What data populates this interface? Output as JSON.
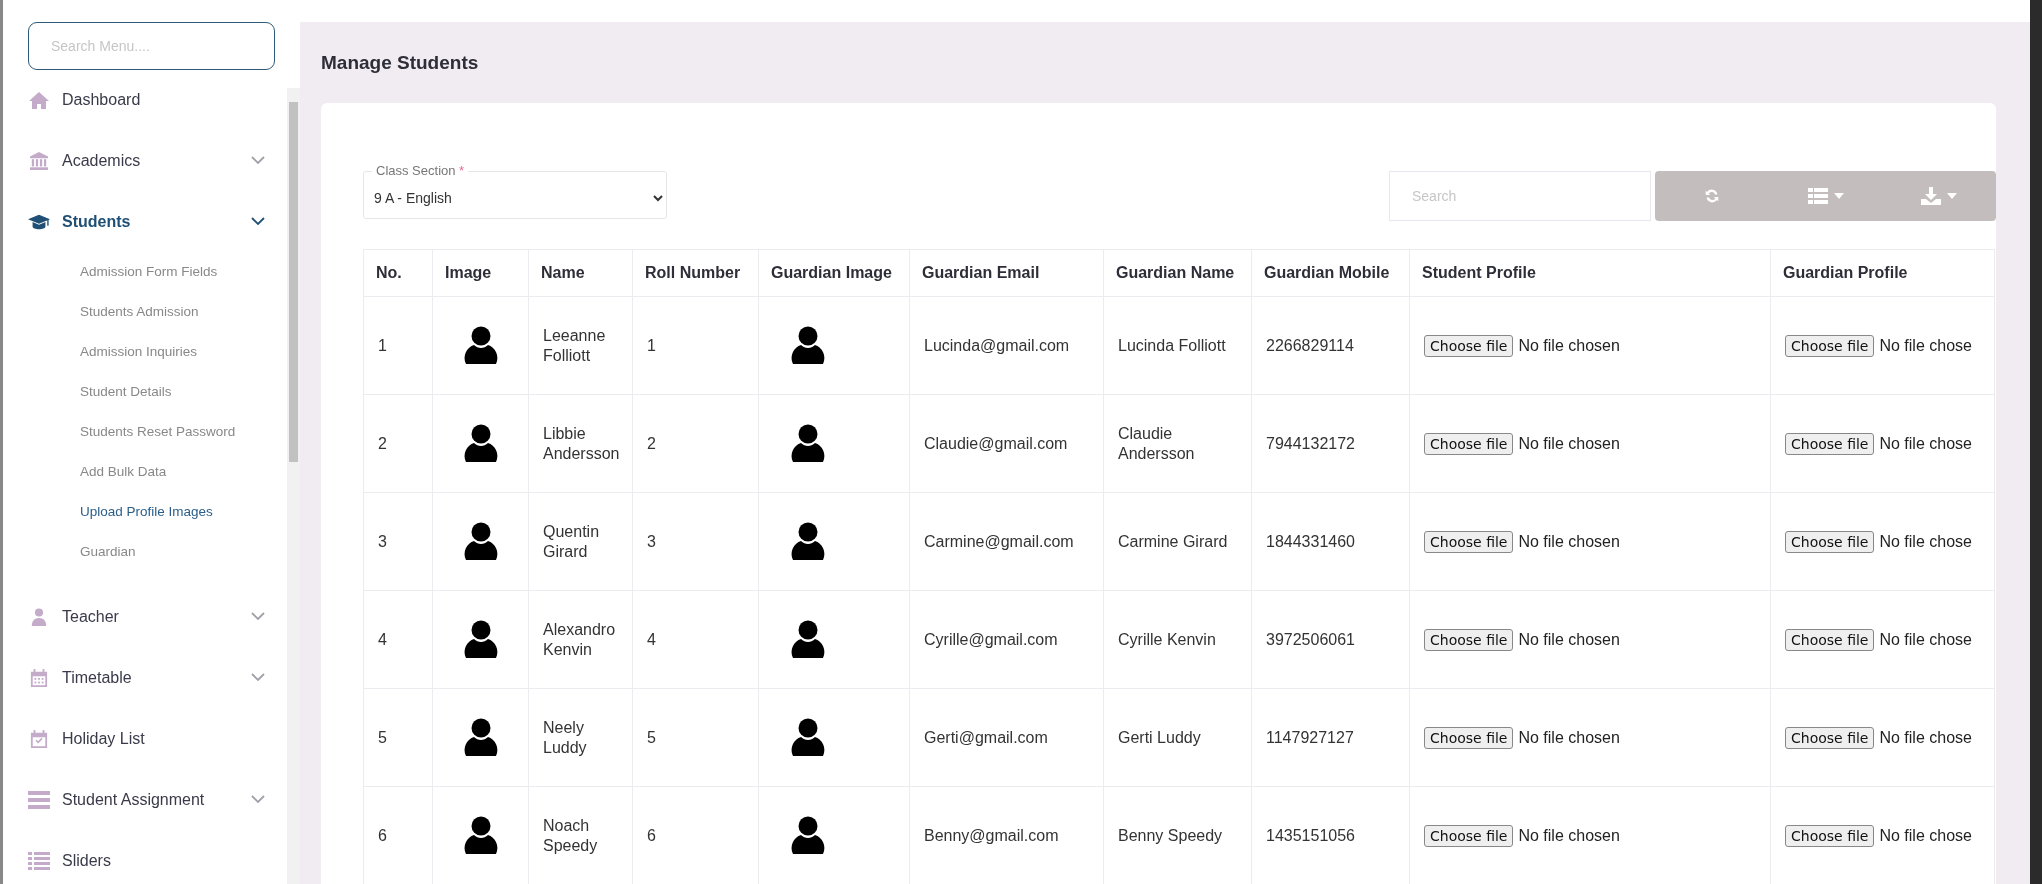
{
  "sidebar": {
    "search": {
      "placeholder": "Search Menu...."
    },
    "items": [
      {
        "label": "Dashboard",
        "kind": "link"
      },
      {
        "label": "Academics",
        "kind": "group",
        "expanded": false
      },
      {
        "label": "Students",
        "kind": "group",
        "expanded": true,
        "children": [
          {
            "label": "Admission Form Fields",
            "selected": false
          },
          {
            "label": "Students Admission",
            "selected": false
          },
          {
            "label": "Admission Inquiries",
            "selected": false
          },
          {
            "label": "Student Details",
            "selected": false
          },
          {
            "label": "Students Reset Password",
            "selected": false
          },
          {
            "label": "Add Bulk Data",
            "selected": false
          },
          {
            "label": "Upload Profile Images",
            "selected": true
          },
          {
            "label": "Guardian",
            "selected": false
          }
        ]
      },
      {
        "label": "Teacher",
        "kind": "group",
        "expanded": false
      },
      {
        "label": "Timetable",
        "kind": "group",
        "expanded": false
      },
      {
        "label": "Holiday List",
        "kind": "link"
      },
      {
        "label": "Student Assignment",
        "kind": "group",
        "expanded": false
      },
      {
        "label": "Sliders",
        "kind": "link"
      }
    ]
  },
  "page": {
    "title": "Manage Students"
  },
  "filter": {
    "label": "Class Section",
    "required_mark": "*",
    "value": "9 A - English"
  },
  "toolbar": {
    "search": {
      "placeholder": "Search"
    }
  },
  "table": {
    "columns": [
      "No.",
      "Image",
      "Name",
      "Roll Number",
      "Guardian Image",
      "Guardian Email",
      "Guardian Name",
      "Guardian Mobile",
      "Student Profile",
      "Guardian Profile"
    ],
    "rows": [
      {
        "no": "1",
        "name": "Leeanne Folliott",
        "roll": "1",
        "guardian_email": "Lucinda@gmail.com",
        "guardian_name": "Lucinda Folliott",
        "guardian_mobile": "2266829114",
        "student_profile": {
          "button": "Choose file",
          "status": "No file chosen"
        },
        "guardian_profile": {
          "button": "Choose file",
          "status": "No file chose"
        }
      },
      {
        "no": "2",
        "name": "Libbie Andersson",
        "roll": "2",
        "guardian_email": "Claudie@gmail.com",
        "guardian_name": "Claudie Andersson",
        "guardian_mobile": "7944132172",
        "student_profile": {
          "button": "Choose file",
          "status": "No file chosen"
        },
        "guardian_profile": {
          "button": "Choose file",
          "status": "No file chose"
        }
      },
      {
        "no": "3",
        "name": "Quentin Girard",
        "roll": "3",
        "guardian_email": "Carmine@gmail.com",
        "guardian_name": "Carmine Girard",
        "guardian_mobile": "1844331460",
        "student_profile": {
          "button": "Choose file",
          "status": "No file chosen"
        },
        "guardian_profile": {
          "button": "Choose file",
          "status": "No file chose"
        }
      },
      {
        "no": "4",
        "name": "Alexandro Kenvin",
        "roll": "4",
        "guardian_email": "Cyrille@gmail.com",
        "guardian_name": "Cyrille Kenvin",
        "guardian_mobile": "3972506061",
        "student_profile": {
          "button": "Choose file",
          "status": "No file chosen"
        },
        "guardian_profile": {
          "button": "Choose file",
          "status": "No file chose"
        }
      },
      {
        "no": "5",
        "name": "Neely Luddy",
        "roll": "5",
        "guardian_email": "Gerti@gmail.com",
        "guardian_name": "Gerti Luddy",
        "guardian_mobile": "1147927127",
        "student_profile": {
          "button": "Choose file",
          "status": "No file chosen"
        },
        "guardian_profile": {
          "button": "Choose file",
          "status": "No file chose"
        }
      },
      {
        "no": "6",
        "name": "Noach Speedy",
        "roll": "6",
        "guardian_email": "Benny@gmail.com",
        "guardian_name": "Benny Speedy",
        "guardian_mobile": "1435151056",
        "student_profile": {
          "button": "Choose file",
          "status": "No file chosen"
        },
        "guardian_profile": {
          "button": "Choose file",
          "status": "No file chose"
        }
      }
    ]
  }
}
